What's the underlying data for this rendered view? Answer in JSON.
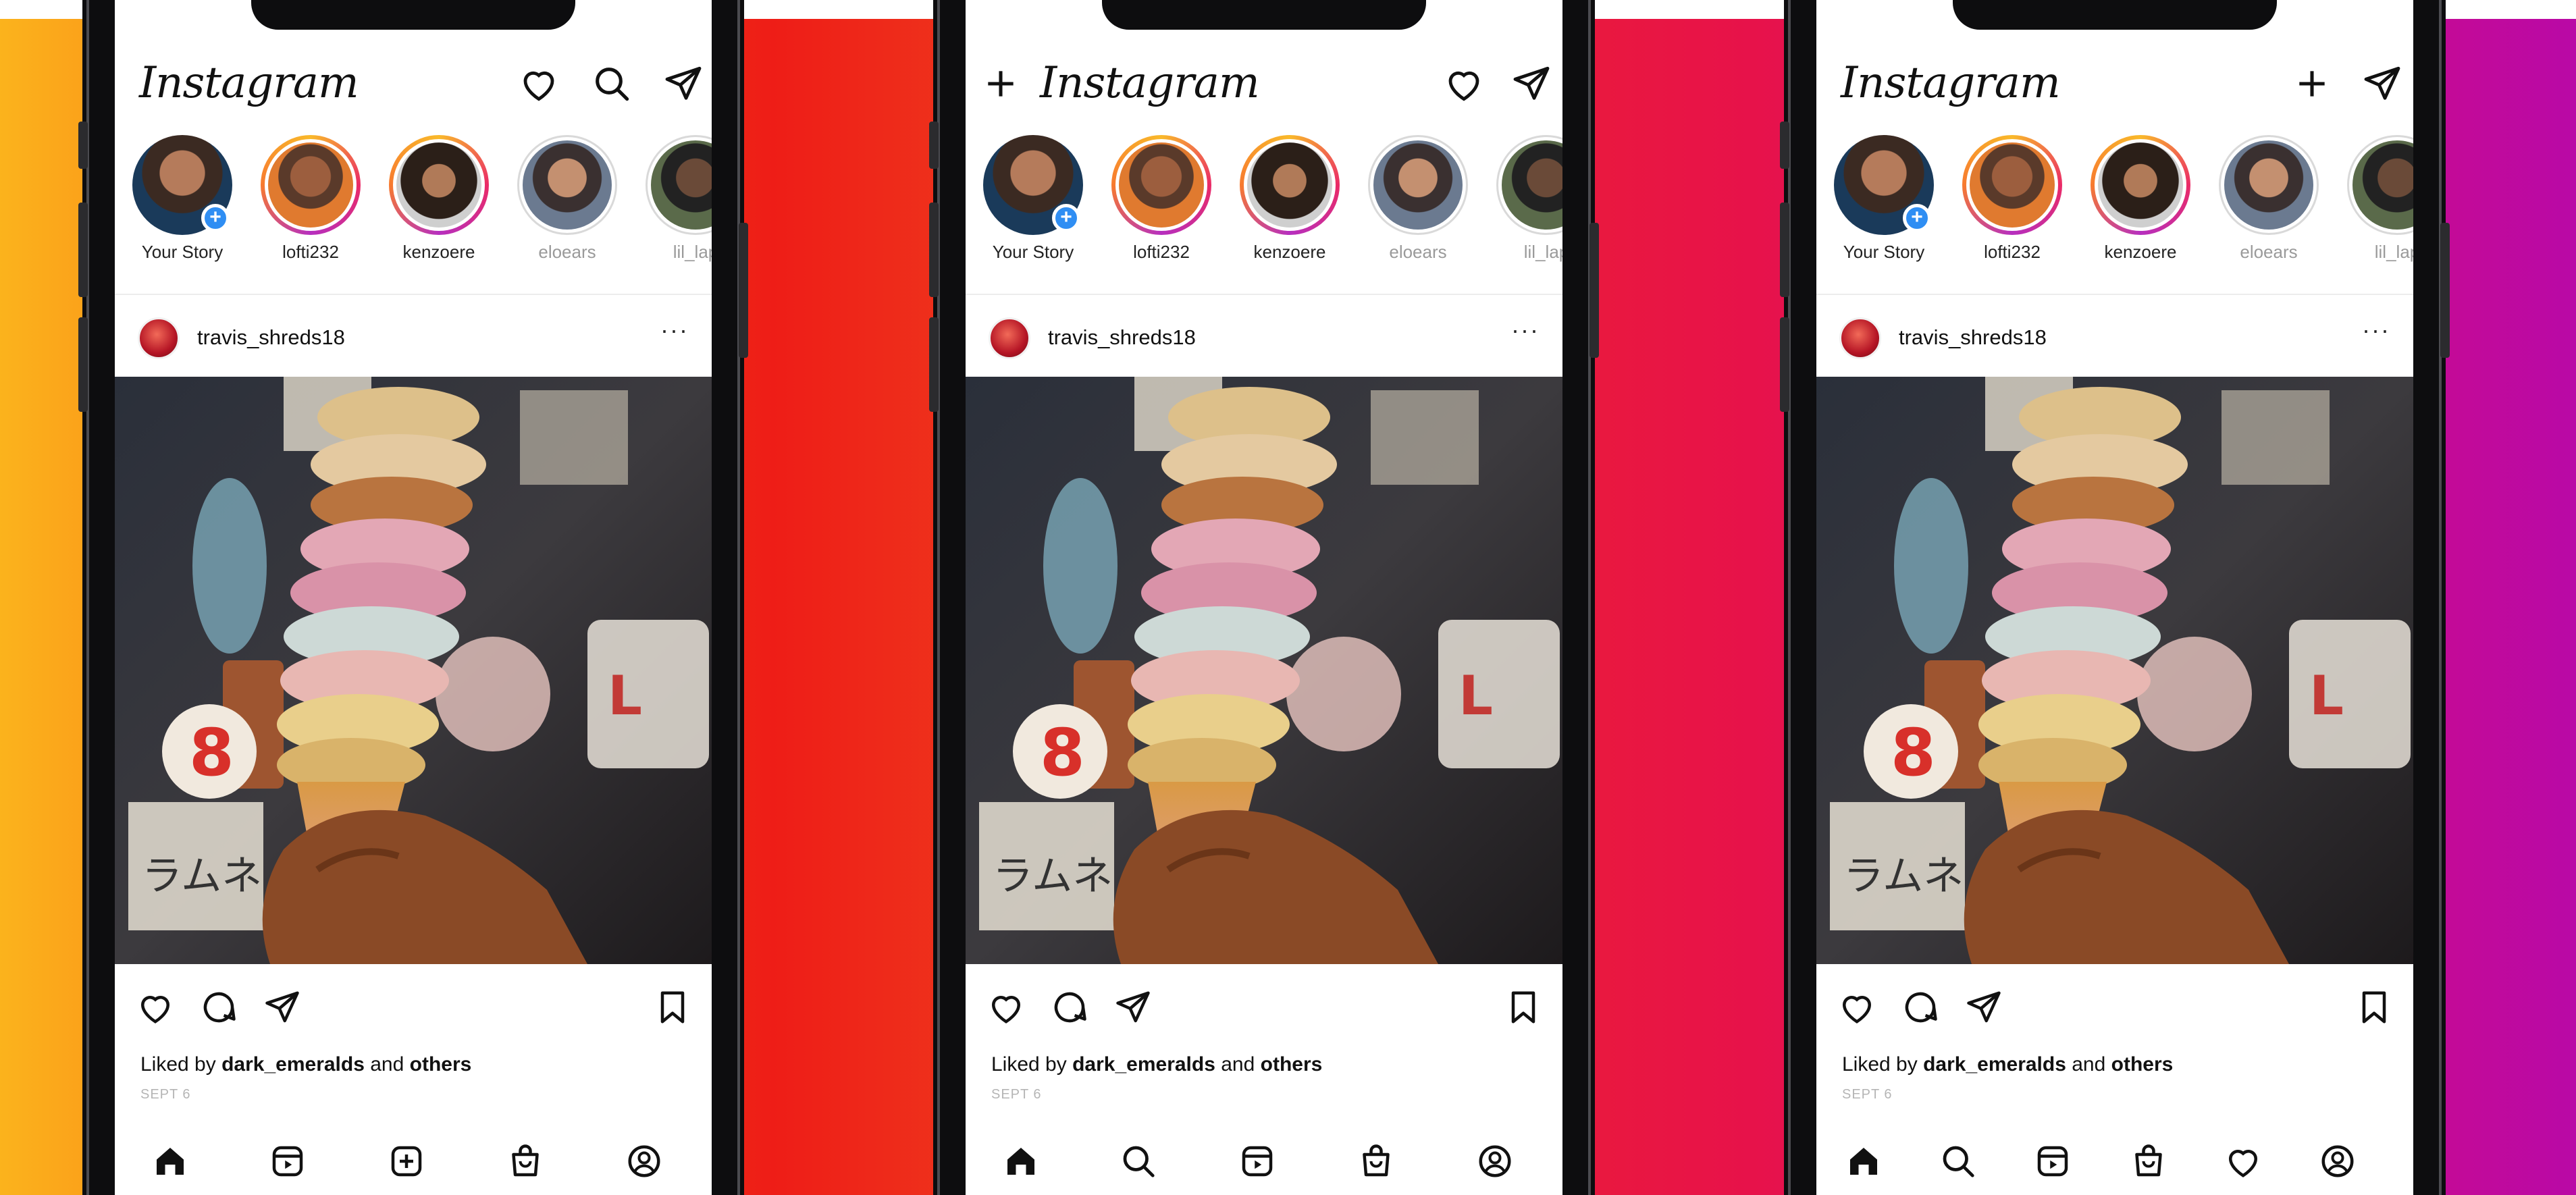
{
  "brand": {
    "app_name": "Instagram"
  },
  "colors": {
    "accent_blue": "#2f8ef3",
    "ring_gradient": [
      "#f9b92a",
      "#ea2a67",
      "#b62fbf"
    ]
  },
  "phones": [
    {
      "variant": "current",
      "header": {
        "left_icon": "",
        "icons": [
          "heart-icon",
          "search-icon",
          "send-icon"
        ]
      },
      "stories": [
        {
          "name": "Your Story",
          "own": true
        },
        {
          "name": "lofti232"
        },
        {
          "name": "kenzoere"
        },
        {
          "name": "eloears"
        },
        {
          "name": "lil_lap"
        }
      ],
      "post": {
        "username": "travis_shreds18",
        "more": "···",
        "liked_prefix": "Liked by",
        "liked_user": "dark_emeralds",
        "liked_mid": "and",
        "liked_suffix": "others",
        "date": "SEPT 6"
      },
      "tabs": [
        "home-icon",
        "reels-icon",
        "create-icon",
        "shop-icon",
        "profile-icon"
      ]
    },
    {
      "variant": "test-a",
      "header": {
        "left_icon": "plus-icon",
        "icons": [
          "heart-icon",
          "send-icon"
        ]
      },
      "stories": [
        {
          "name": "Your Story",
          "own": true
        },
        {
          "name": "lofti232"
        },
        {
          "name": "kenzoere"
        },
        {
          "name": "eloears"
        },
        {
          "name": "lil_lap"
        }
      ],
      "post": {
        "username": "travis_shreds18",
        "more": "···",
        "liked_prefix": "Liked by",
        "liked_user": "dark_emeralds",
        "liked_mid": "and",
        "liked_suffix": "others",
        "date": "SEPT 6"
      },
      "tabs": [
        "home-icon",
        "search-icon",
        "reels-icon",
        "shop-icon",
        "profile-icon"
      ]
    },
    {
      "variant": "test-b",
      "header": {
        "left_icon": "",
        "icons": [
          "plus-icon",
          "send-icon"
        ]
      },
      "stories": [
        {
          "name": "Your Story",
          "own": true
        },
        {
          "name": "lofti232"
        },
        {
          "name": "kenzoere"
        },
        {
          "name": "eloears"
        },
        {
          "name": "lil_lap"
        }
      ],
      "post": {
        "username": "travis_shreds18",
        "more": "···",
        "liked_prefix": "Liked by",
        "liked_user": "dark_emeralds",
        "liked_mid": "and",
        "liked_suffix": "others",
        "date": "SEPT 6"
      },
      "tabs": [
        "home-icon",
        "search-icon",
        "reels-icon",
        "shop-icon",
        "heart-icon",
        "profile-icon"
      ]
    }
  ]
}
